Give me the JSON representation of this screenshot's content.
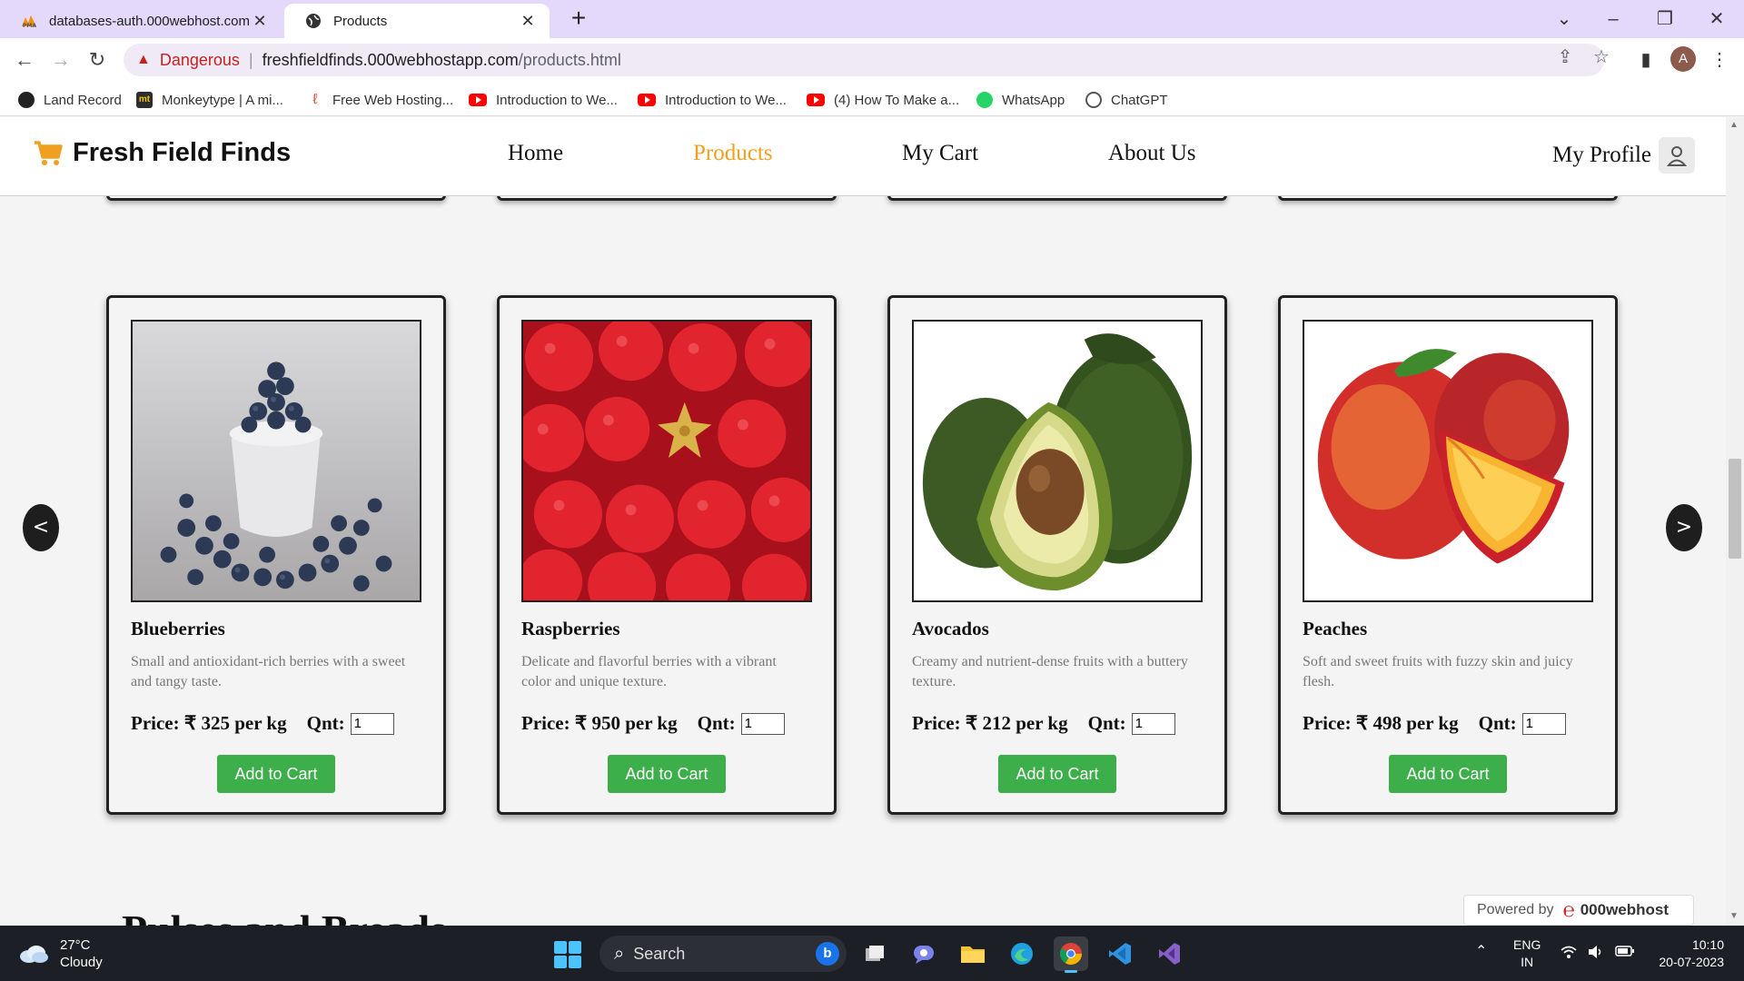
{
  "browser": {
    "tabs": [
      {
        "title": "databases-auth.000webhost.com",
        "favicon": "pma-icon",
        "active": false
      },
      {
        "title": "Products",
        "favicon": "globe-icon",
        "active": true
      }
    ],
    "address": {
      "security_label": "Dangerous",
      "host": "freshfieldfinds.000webhostapp.com",
      "path": "/products.html"
    },
    "profile_initial": "A",
    "bookmarks": [
      {
        "label": "Land Record",
        "icon": "globe-icon"
      },
      {
        "label": "Monkeytype | A mi...",
        "icon": "monkeytype-icon",
        "icon_text": "mt"
      },
      {
        "label": "Free Web Hosting...",
        "icon": "webhost-icon"
      },
      {
        "label": "Introduction to We...",
        "icon": "youtube-icon"
      },
      {
        "label": "Introduction to We...",
        "icon": "youtube-icon"
      },
      {
        "label": "(4) How To Make a...",
        "icon": "youtube-icon"
      },
      {
        "label": "WhatsApp",
        "icon": "whatsapp-icon"
      },
      {
        "label": "ChatGPT",
        "icon": "chatgpt-icon"
      }
    ]
  },
  "site": {
    "brand": "Fresh Field Finds",
    "nav": {
      "home": "Home",
      "products": "Products",
      "cart": "My Cart",
      "about": "About Us",
      "profile": "My Profile"
    },
    "accent_color": "#f0a020",
    "button_color": "#3cae4a",
    "carousel": {
      "prev": "<",
      "next": ">"
    },
    "products": [
      {
        "name": "Blueberries",
        "description": "Small and antioxidant-rich berries with a sweet and tangy taste.",
        "price": "Price: ₹ 325 per kg",
        "qnt_label": "Qnt:",
        "qnt": "1",
        "button": "Add to Cart"
      },
      {
        "name": "Raspberries",
        "description": "Delicate and flavorful berries with a vibrant color and unique texture.",
        "price": "Price: ₹ 950 per kg",
        "qnt_label": "Qnt:",
        "qnt": "1",
        "button": "Add to Cart"
      },
      {
        "name": "Avocados",
        "description": "Creamy and nutrient-dense fruits with a buttery texture.",
        "price": "Price: ₹ 212 per kg",
        "qnt_label": "Qnt:",
        "qnt": "1",
        "button": "Add to Cart"
      },
      {
        "name": "Peaches",
        "description": "Soft and sweet fruits with fuzzy skin and juicy flesh.",
        "price": "Price: ₹ 498 per kg",
        "qnt_label": "Qnt:",
        "qnt": "1",
        "button": "Add to Cart"
      }
    ],
    "next_section_heading": "Pulses and Breads",
    "powered_by": {
      "label": "Powered by",
      "brand": "000webhost"
    }
  },
  "taskbar": {
    "weather": {
      "temp": "27°C",
      "condition": "Cloudy"
    },
    "search_placeholder": "Search",
    "language": {
      "line1": "ENG",
      "line2": "IN"
    },
    "time": "10:10",
    "date": "20-07-2023"
  }
}
